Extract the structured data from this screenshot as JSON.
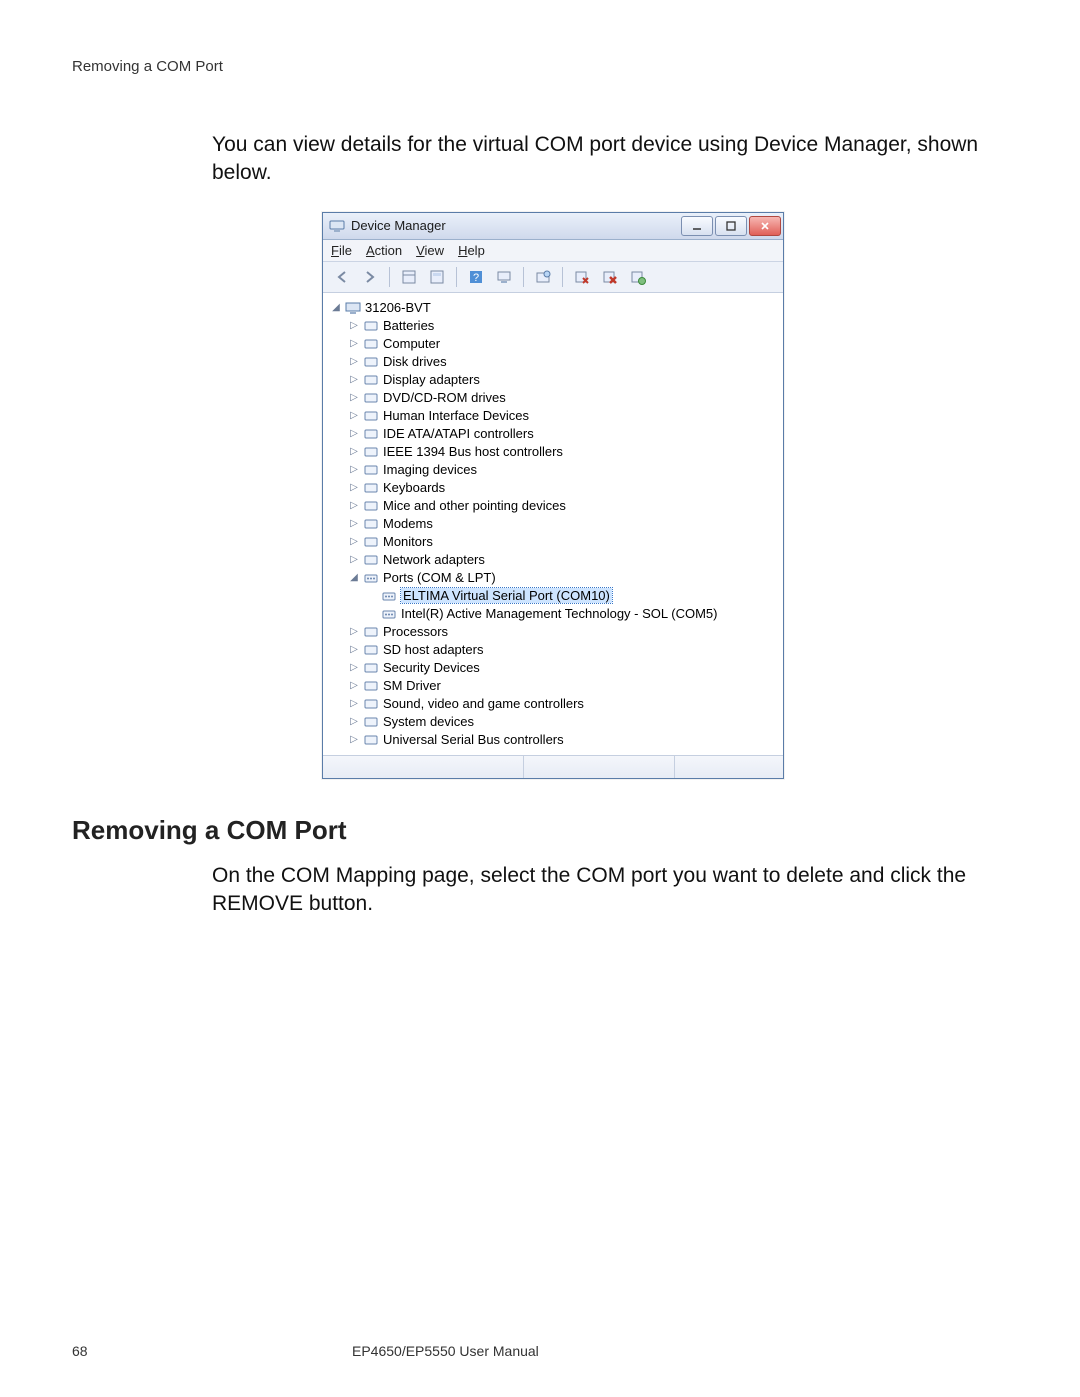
{
  "header": {
    "running_head": "Removing a COM Port"
  },
  "intro_para": "You can view details for the virtual COM port device using Device Manager, shown below.",
  "device_manager": {
    "title": "Device Manager",
    "menus": {
      "file": "File",
      "action": "Action",
      "view": "View",
      "help": "Help"
    },
    "root": "31206-BVT",
    "categories": [
      "Batteries",
      "Computer",
      "Disk drives",
      "Display adapters",
      "DVD/CD-ROM drives",
      "Human Interface Devices",
      "IDE ATA/ATAPI controllers",
      "IEEE 1394 Bus host controllers",
      "Imaging devices",
      "Keyboards",
      "Mice and other pointing devices",
      "Modems",
      "Monitors",
      "Network adapters"
    ],
    "ports_label": "Ports (COM & LPT)",
    "ports_children": [
      "ELTIMA Virtual Serial Port (COM10)",
      "Intel(R) Active Management Technology - SOL (COM5)"
    ],
    "categories_after": [
      "Processors",
      "SD host adapters",
      "Security Devices",
      "SM Driver",
      "Sound, video and game controllers",
      "System devices",
      "Universal Serial Bus controllers"
    ]
  },
  "section_heading": "Removing a COM Port",
  "remove_para_before": "On the COM Mapping page, select the COM port you want to delete and click the ",
  "remove_button_label": "REMOVE",
  "remove_para_after": " button.",
  "footer": {
    "page_number": "68",
    "title": "EP4650/EP5550 User Manual"
  }
}
